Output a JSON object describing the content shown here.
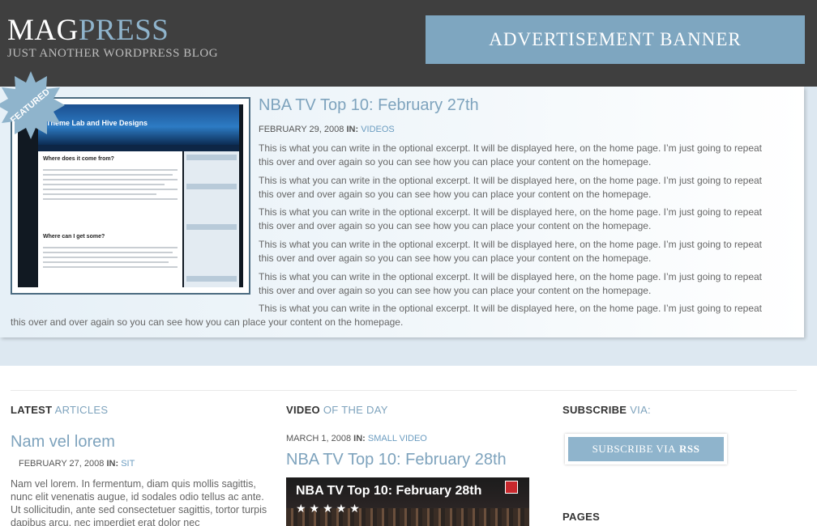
{
  "header": {
    "logo_part1": "MAG",
    "logo_part2": "PRESS",
    "tagline": "JUST ANOTHER WORDPRESS BLOG",
    "ad_banner": "ADVERTISEMENT BANNER"
  },
  "featured": {
    "badge": "FEATURED",
    "thumb_site_title": "Theme Lab and Hive Designs",
    "thumb_heading1": "Where does it come from?",
    "thumb_heading2": "Where can I get some?",
    "title": "NBA TV Top 10: February 27th",
    "date": "FEBRUARY 29, 2008",
    "in_label": "IN:",
    "category": "VIDEOS",
    "excerpt": "This is what you can write in the optional excerpt. It will be displayed here, on the home page. I’m just going to repeat this over and over again so you can see how you can place your content on the homepage."
  },
  "latest": {
    "heading_bold": "LATEST",
    "heading_rest": "ARTICLES",
    "post_title": "Nam vel lorem",
    "date": "FEBRUARY 27, 2008",
    "in_label": "IN:",
    "category": "SIT",
    "excerpt": "Nam vel lorem. In fermentum, diam quis mollis sagittis, nunc elit venenatis augue, id sodales odio tellus ac ante. Ut sollicitudin, ante sed consectetuer sagittis, tortor turpis dapibus arcu, nec imperdiet erat dolor nec"
  },
  "video": {
    "heading_bold": "VIDEO",
    "heading_rest": "OF THE DAY",
    "date": "MARCH 1, 2008",
    "in_label": "IN:",
    "category": "SMALL VIDEO",
    "post_title": "NBA TV Top 10: February 28th",
    "overlay_title": "NBA TV Top 10: February 28th",
    "stars": "★★★★★"
  },
  "subscribe": {
    "heading_bold": "SUBSCRIBE",
    "heading_rest": "VIA:",
    "button_text": "SUBSCRIBE VIA",
    "button_bold": "RSS",
    "pages_heading": "PAGES"
  }
}
